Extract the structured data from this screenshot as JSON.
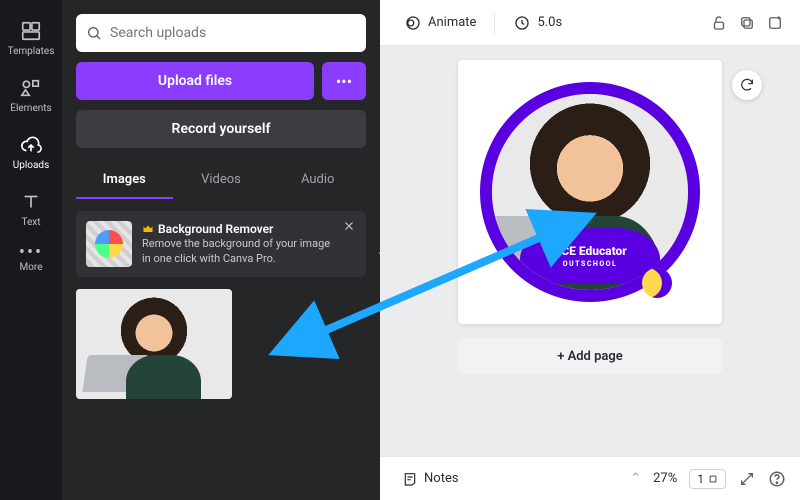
{
  "rail": {
    "templates": "Templates",
    "elements": "Elements",
    "uploads": "Uploads",
    "text": "Text",
    "more": "More"
  },
  "panel": {
    "search_placeholder": "Search uploads",
    "upload_label": "Upload files",
    "record_label": "Record yourself",
    "tabs": {
      "images": "Images",
      "videos": "Videos",
      "audio": "Audio"
    },
    "promo": {
      "title": "Background Remover",
      "desc": "Remove the background of your image in one click with Canva Pro."
    }
  },
  "topbar": {
    "animate": "Animate",
    "duration": "5.0s"
  },
  "canvas": {
    "badge_title": "ACE Educator",
    "badge_sub": "OUTSCHOOL",
    "add_page": "+ Add page"
  },
  "footer": {
    "notes": "Notes",
    "zoom": "27%",
    "page_current": "1"
  },
  "colors": {
    "accent": "#8b3dff",
    "ring": "#5a00e0"
  }
}
